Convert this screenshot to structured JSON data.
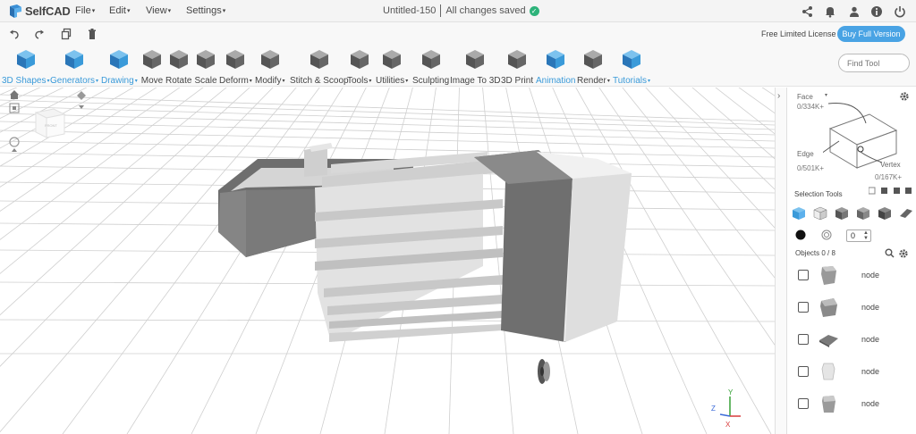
{
  "app": {
    "brand": "SelfCAD",
    "document_title": "Untitled-150",
    "save_status": "All changes saved"
  },
  "menu": [
    {
      "label": "File"
    },
    {
      "label": "Edit"
    },
    {
      "label": "View"
    },
    {
      "label": "Settings"
    }
  ],
  "header_icons": [
    "share-icon",
    "bell-icon",
    "user-icon",
    "info-icon",
    "power-icon"
  ],
  "subbar": {
    "icons": [
      "undo-icon",
      "redo-icon",
      "copy-icon",
      "trash-icon"
    ],
    "license_text": "Free Limited License",
    "buy_label": "Buy Full Version"
  },
  "toolbar": {
    "tools": [
      {
        "label": "3D Shapes",
        "dropdown": true,
        "highlight": true,
        "icon": "cube-icon"
      },
      {
        "label": "Generators",
        "dropdown": true,
        "highlight": true,
        "icon": "generators-icon"
      },
      {
        "label": "Drawing",
        "dropdown": true,
        "highlight": true,
        "icon": "drawing-icon"
      },
      {
        "label": "Move",
        "dropdown": false,
        "highlight": false,
        "icon": "move-icon"
      },
      {
        "label": "Rotate",
        "dropdown": false,
        "highlight": false,
        "icon": "rotate-icon"
      },
      {
        "label": "Scale",
        "dropdown": false,
        "highlight": false,
        "icon": "scale-icon"
      },
      {
        "label": "Deform",
        "dropdown": true,
        "highlight": false,
        "icon": "deform-icon"
      },
      {
        "label": "Modify",
        "dropdown": true,
        "highlight": false,
        "icon": "modify-icon"
      },
      {
        "label": "Stitch & Scoop",
        "dropdown": false,
        "highlight": false,
        "icon": "stitch-scoop-icon"
      },
      {
        "label": "Tools",
        "dropdown": true,
        "highlight": false,
        "icon": "tools-icon"
      },
      {
        "label": "Utilities",
        "dropdown": true,
        "highlight": false,
        "icon": "utilities-icon"
      },
      {
        "label": "Sculpting",
        "dropdown": false,
        "highlight": false,
        "icon": "sculpting-icon"
      },
      {
        "label": "Image To 3D",
        "dropdown": false,
        "highlight": false,
        "icon": "image-to-3d-icon"
      },
      {
        "label": "3D Print",
        "dropdown": false,
        "highlight": false,
        "icon": "3d-print-icon"
      },
      {
        "label": "Animation",
        "dropdown": false,
        "highlight": true,
        "icon": "animation-icon"
      },
      {
        "label": "Render",
        "dropdown": true,
        "highlight": false,
        "icon": "render-icon"
      },
      {
        "label": "Tutorials",
        "dropdown": true,
        "highlight": true,
        "icon": "tutorials-icon"
      }
    ],
    "search_placeholder": "Find Tool"
  },
  "viewport": {
    "view_cube_label": "FRONT",
    "axis_labels": {
      "y": "Y",
      "z": "Z",
      "x": "X"
    }
  },
  "panel": {
    "selection": {
      "face_label": "Face",
      "face_count": "0/334K+",
      "edge_label": "Edge",
      "edge_count": "0/501K+",
      "vertex_label": "Vertex",
      "vertex_count": "0/167K+"
    },
    "selection_tools_title": "Selection Tools",
    "stepper_value": "0",
    "objects_title": "Objects 0 / 8",
    "objects": [
      {
        "name": "node"
      },
      {
        "name": "node"
      },
      {
        "name": "node"
      },
      {
        "name": "node"
      },
      {
        "name": "node"
      }
    ]
  },
  "colors": {
    "accent": "#49a3e4",
    "highlight_text": "#3a9ad9",
    "saved_check": "#2db37a"
  }
}
